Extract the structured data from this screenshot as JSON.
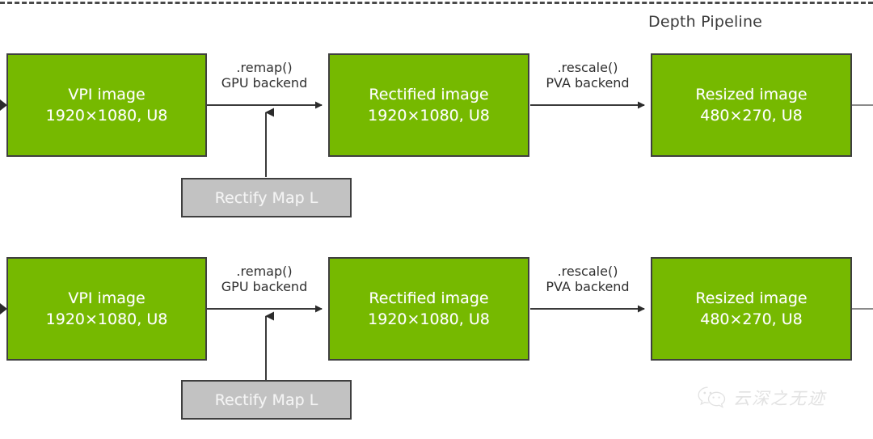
{
  "diagram": {
    "group_title": "Depth Pipeline",
    "group_border_style": "dashed",
    "colors": {
      "process_fill": "#76b900",
      "process_border": "#3f3f3f",
      "process_text": "#ffffff",
      "data_fill": "#c2c2c2",
      "data_border": "#3f3f3f",
      "data_text": "#f4f4f4",
      "edge_stroke": "#3a3a3a",
      "label_text": "#2f2f2f",
      "group_dash": "#4a4a4a",
      "watermark_text": "#e2e2e2"
    },
    "rows": [
      {
        "id": "left-camera-row",
        "nodes": [
          {
            "id": "vpi-image-top",
            "kind": "process",
            "line1": "VPI image",
            "line2": "1920×1080,  U8"
          },
          {
            "id": "rectified-image-top",
            "kind": "process",
            "line1": "Rectified image",
            "line2": "1920×1080,  U8"
          },
          {
            "id": "resized-image-top",
            "kind": "process",
            "line1": "Resized image",
            "line2": "480×270,  U8"
          }
        ],
        "edges": [
          {
            "id": "remap-top",
            "line1": ".remap()",
            "line2": "GPU backend"
          },
          {
            "id": "rescale-top",
            "line1": ".rescale()",
            "line2": "PVA backend"
          }
        ],
        "data_node": {
          "id": "rectify-map-l-top",
          "kind": "data",
          "label": "Rectify Map L"
        }
      },
      {
        "id": "right-camera-row",
        "nodes": [
          {
            "id": "vpi-image-bottom",
            "kind": "process",
            "line1": "VPI image",
            "line2": "1920×1080,  U8"
          },
          {
            "id": "rectified-image-bottom",
            "kind": "process",
            "line1": "Rectified image",
            "line2": "1920×1080,  U8"
          },
          {
            "id": "resized-image-bottom",
            "kind": "process",
            "line1": "Resized image",
            "line2": "480×270,  U8"
          }
        ],
        "edges": [
          {
            "id": "remap-bottom",
            "line1": ".remap()",
            "line2": "GPU backend"
          },
          {
            "id": "rescale-bottom",
            "line1": ".rescale()",
            "line2": "PVA backend"
          }
        ],
        "data_node": {
          "id": "rectify-map-l-bottom",
          "kind": "data",
          "label": "Rectify Map L"
        }
      }
    ],
    "watermark": {
      "icon": "wechat-icon",
      "text": "云深之无迹"
    }
  }
}
